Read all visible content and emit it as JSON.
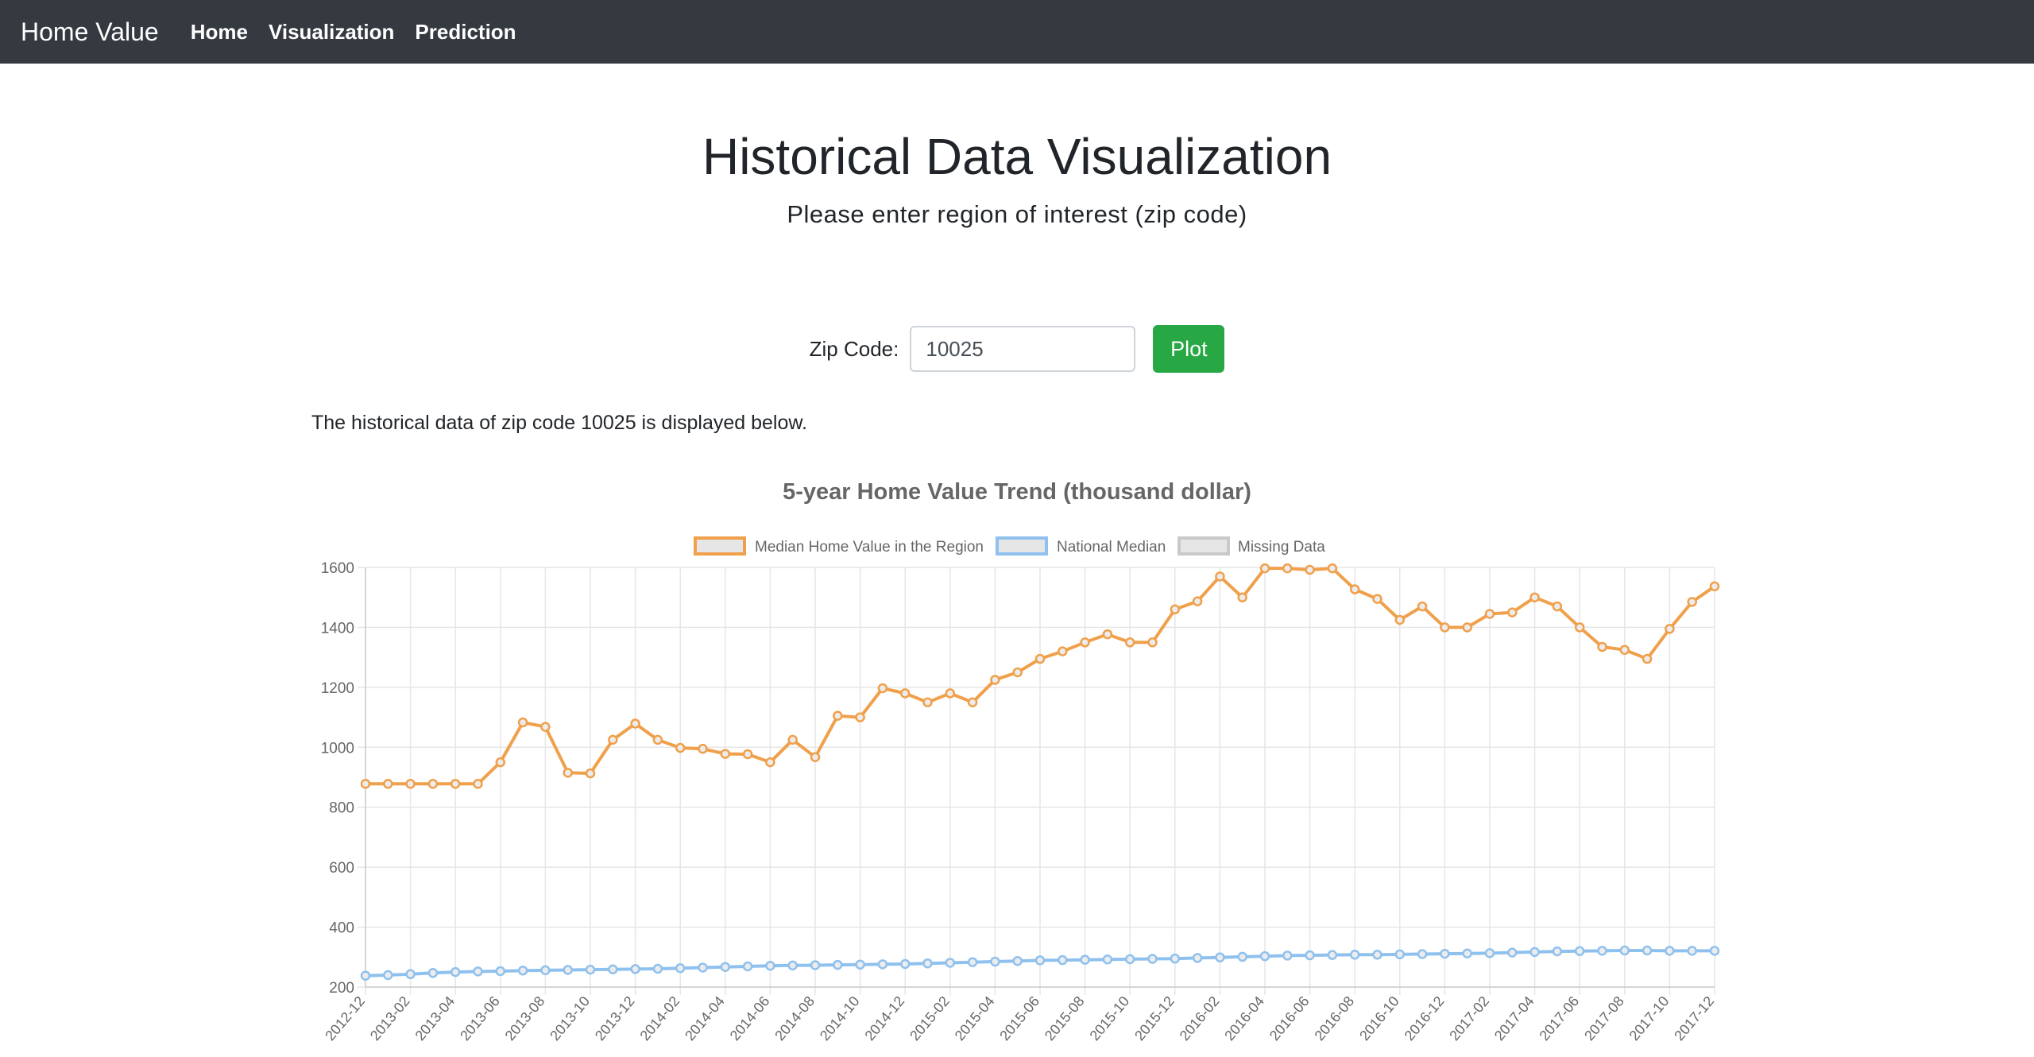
{
  "nav": {
    "brand": "Home Value",
    "links": [
      "Home",
      "Visualization",
      "Prediction"
    ]
  },
  "page": {
    "title": "Historical Data Visualization",
    "subtitle": "Please enter region of interest (zip code)"
  },
  "form": {
    "label": "Zip Code:",
    "value": "10025",
    "button": "Plot"
  },
  "description": "The historical data of zip code 10025 is displayed below.",
  "colors": {
    "navbar": "#343a40",
    "button": "#28a745",
    "region_series": "#f0a04b",
    "national_series": "#8fc1ee",
    "missing_series": "#c9c9c9"
  },
  "chart_data": {
    "type": "line",
    "title": "5-year Home Value Trend (thousand dollar)",
    "legend_position": "top",
    "grid": true,
    "ylim": [
      200,
      1600
    ],
    "yticks": [
      200,
      400,
      600,
      800,
      1000,
      1200,
      1400,
      1600
    ],
    "x": [
      "2012-12",
      "2013-01",
      "2013-02",
      "2013-03",
      "2013-04",
      "2013-05",
      "2013-06",
      "2013-07",
      "2013-08",
      "2013-09",
      "2013-10",
      "2013-11",
      "2013-12",
      "2014-01",
      "2014-02",
      "2014-03",
      "2014-04",
      "2014-05",
      "2014-06",
      "2014-07",
      "2014-08",
      "2014-09",
      "2014-10",
      "2014-11",
      "2014-12",
      "2015-01",
      "2015-02",
      "2015-03",
      "2015-04",
      "2015-05",
      "2015-06",
      "2015-07",
      "2015-08",
      "2015-09",
      "2015-10",
      "2015-11",
      "2015-12",
      "2016-01",
      "2016-02",
      "2016-03",
      "2016-04",
      "2016-05",
      "2016-06",
      "2016-07",
      "2016-08",
      "2016-09",
      "2016-10",
      "2016-11",
      "2016-12",
      "2017-01",
      "2017-02",
      "2017-03",
      "2017-04",
      "2017-05",
      "2017-06",
      "2017-07",
      "2017-08",
      "2017-09",
      "2017-10",
      "2017-11",
      "2017-12"
    ],
    "x_tick_labels": [
      "2012-12",
      "2013-02",
      "2013-04",
      "2013-06",
      "2013-08",
      "2013-10",
      "2013-12",
      "2014-02",
      "2014-04",
      "2014-06",
      "2014-08",
      "2014-10",
      "2014-12",
      "2015-02",
      "2015-04",
      "2015-06",
      "2015-08",
      "2015-10",
      "2015-12",
      "2016-02",
      "2016-04",
      "2016-06",
      "2016-08",
      "2016-10",
      "2016-12",
      "2017-02",
      "2017-04",
      "2017-06",
      "2017-08",
      "2017-10",
      "2017-12"
    ],
    "series": [
      {
        "name": "Median Home Value in the Region",
        "color": "#f0a04b",
        "values": [
          878,
          878,
          878,
          878,
          878,
          878,
          950,
          1083,
          1068,
          915,
          913,
          1025,
          1079,
          1025,
          998,
          995,
          978,
          977,
          950,
          1025,
          967,
          1105,
          1100,
          1197,
          1180,
          1150,
          1180,
          1150,
          1225,
          1250,
          1295,
          1320,
          1350,
          1377,
          1350,
          1350,
          1460,
          1487,
          1570,
          1500,
          1597,
          1597,
          1592,
          1597,
          1527,
          1495,
          1425,
          1470,
          1400,
          1400,
          1445,
          1450,
          1500,
          1470,
          1400,
          1335,
          1325,
          1295,
          1395,
          1485,
          1537
        ]
      },
      {
        "name": "National Median",
        "color": "#8fc1ee",
        "values": [
          238,
          240,
          243,
          247,
          250,
          252,
          253,
          255,
          256,
          257,
          258,
          259,
          260,
          261,
          263,
          265,
          267,
          269,
          271,
          272,
          273,
          274,
          275,
          276,
          277,
          279,
          281,
          283,
          285,
          287,
          289,
          290,
          291,
          292,
          293,
          294,
          295,
          297,
          299,
          301,
          303,
          305,
          306,
          307,
          308,
          308,
          309,
          310,
          311,
          312,
          313,
          315,
          317,
          319,
          320,
          321,
          322,
          322,
          321,
          321,
          321
        ]
      },
      {
        "name": "Missing Data",
        "color": "#c9c9c9",
        "values": []
      }
    ]
  }
}
